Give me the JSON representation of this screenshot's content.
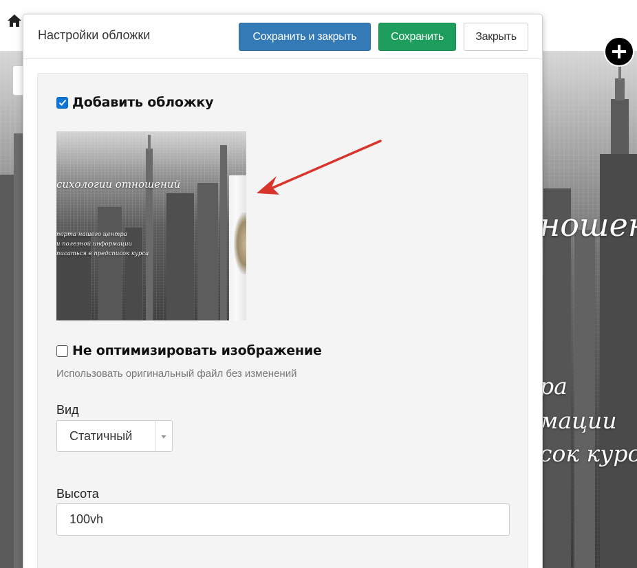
{
  "modal": {
    "title": "Настройки обложки",
    "buttons": {
      "save_close": "Сохранить и закрыть",
      "save": "Сохранить",
      "close": "Закрыть"
    },
    "add_cover": {
      "label": "Добавить обложку",
      "checked": true
    },
    "cover_preview": {
      "title": "сихологии отношений",
      "lines": [
        "перта нашего центра",
        "и полезной информации",
        "писаться в предсписок курса"
      ]
    },
    "no_optimize": {
      "label": "Не оптимизировать изображение",
      "checked": false,
      "help": "Использовать оригинальный файл без изменений"
    },
    "view": {
      "label": "Вид",
      "value": "Статичный"
    },
    "height": {
      "label": "Высота",
      "value": "100vh"
    }
  },
  "background_page": {
    "heading_fragment": "ношен",
    "lines": [
      "ра",
      "мации",
      "сок курс"
    ]
  },
  "icons": {
    "home": "home-icon",
    "add": "plus-icon",
    "check": "check-icon",
    "dropdown": "caret-down-icon",
    "annotation": "red-arrow-icon"
  },
  "colors": {
    "primary": "#337ab7",
    "success": "#1e9e5c",
    "checkbox": "#0b75d6",
    "annotation": "#d9342b"
  }
}
